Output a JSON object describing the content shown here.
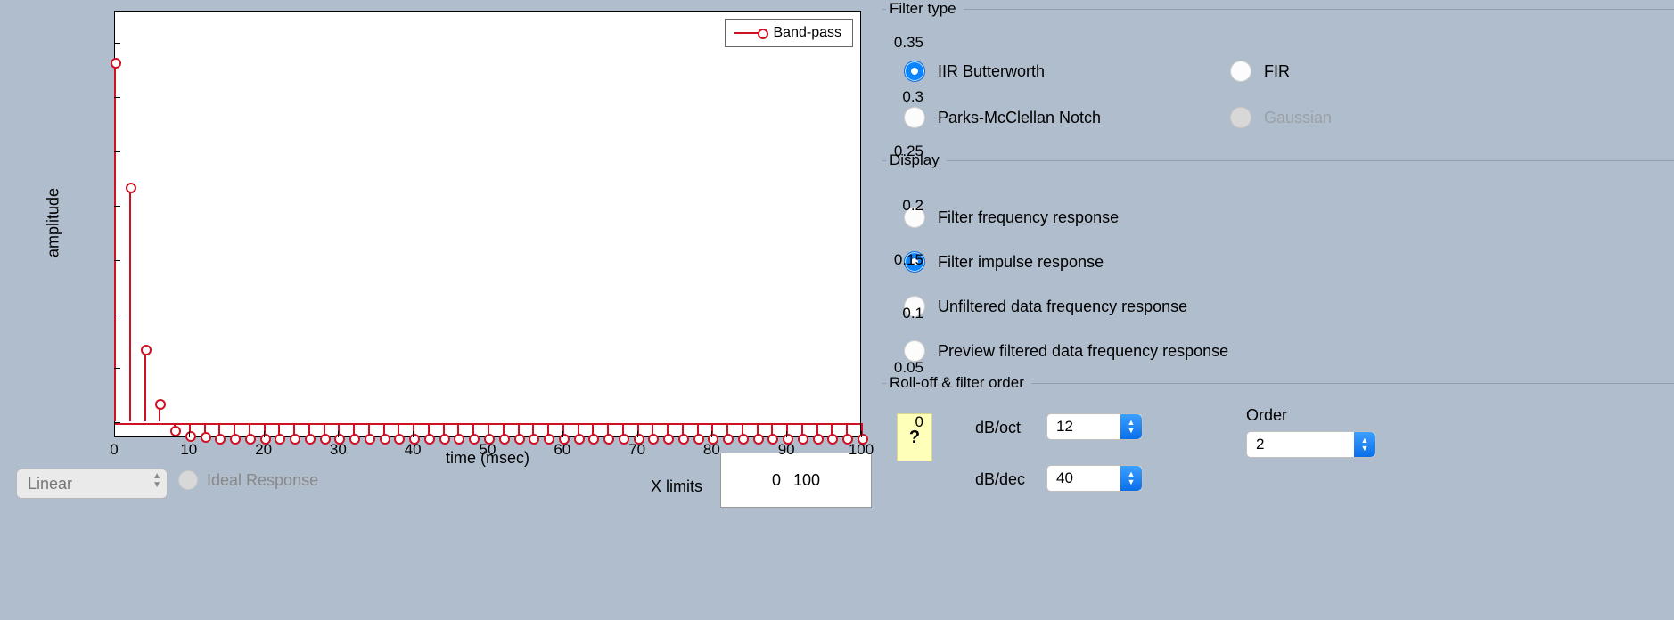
{
  "chart_data": {
    "type": "stem",
    "title": "",
    "xlabel": "time (msec)",
    "ylabel": "amplitude",
    "xlim": [
      0,
      100
    ],
    "ylim": [
      -0.014,
      0.38
    ],
    "xticks": [
      0,
      10,
      20,
      30,
      40,
      50,
      60,
      70,
      80,
      90,
      100
    ],
    "yticks": [
      0,
      0.05,
      0.1,
      0.15,
      0.2,
      0.25,
      0.3,
      0.35
    ],
    "legend": "Band-pass",
    "series": [
      {
        "name": "Band-pass",
        "x": [
          0,
          2,
          4,
          6,
          8,
          10,
          12,
          14,
          16,
          18,
          20,
          22,
          24,
          26,
          28,
          30,
          32,
          34,
          36,
          38,
          40,
          42,
          44,
          46,
          48,
          50,
          52,
          54,
          56,
          58,
          60,
          62,
          64,
          66,
          68,
          70,
          72,
          74,
          76,
          78,
          80,
          82,
          84,
          86,
          88,
          90,
          92,
          94,
          96,
          98,
          100
        ],
        "values": [
          0.328,
          0.213,
          0.063,
          0.013,
          -0.005,
          -0.01,
          -0.011,
          -0.012,
          -0.012,
          -0.012,
          -0.012,
          -0.012,
          -0.012,
          -0.012,
          -0.012,
          -0.012,
          -0.012,
          -0.012,
          -0.012,
          -0.012,
          -0.012,
          -0.012,
          -0.012,
          -0.012,
          -0.012,
          -0.012,
          -0.012,
          -0.012,
          -0.012,
          -0.012,
          -0.012,
          -0.012,
          -0.012,
          -0.012,
          -0.012,
          -0.012,
          -0.012,
          -0.012,
          -0.012,
          -0.012,
          -0.012,
          -0.012,
          -0.012,
          -0.012,
          -0.012,
          -0.012,
          -0.012,
          -0.012,
          -0.012,
          -0.012,
          -0.012
        ]
      }
    ]
  },
  "scale": {
    "value": "Linear"
  },
  "ideal_response_label": "Ideal Response",
  "xlimits": {
    "label": "X limits",
    "lo": "0",
    "hi": "100"
  },
  "filter_type": {
    "legend": "Filter type",
    "iir": "IIR Butterworth",
    "fir": "FIR",
    "pm": "Parks-McClellan Notch",
    "gauss": "Gaussian",
    "selected": "iir"
  },
  "display": {
    "legend": "Display",
    "freq": "Filter frequency response",
    "imp": "Filter impulse response",
    "unf": "Unfiltered data frequency response",
    "prev": "Preview filtered data frequency response",
    "selected": "imp"
  },
  "rolloff": {
    "legend": "Roll-off & filter order",
    "help": "?",
    "db_oct_label": "dB/oct",
    "db_oct_value": "12",
    "db_dec_label": "dB/dec",
    "db_dec_value": "40",
    "order_label": "Order",
    "order_value": "2"
  }
}
